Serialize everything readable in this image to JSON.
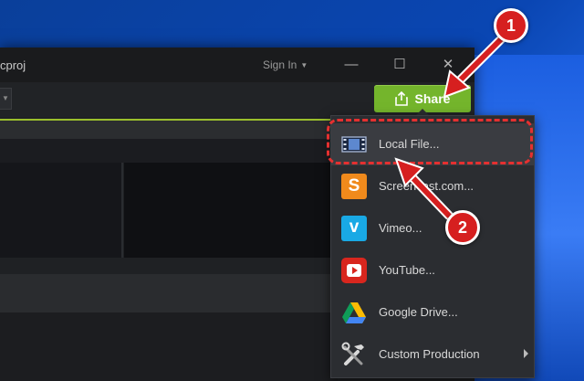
{
  "window": {
    "title": "cproj",
    "sign_in": "Sign In",
    "controls": {
      "minimize": "—",
      "maximize": "☐",
      "close": "✕"
    }
  },
  "share_button": {
    "label": "Share",
    "color": "#74b52c"
  },
  "share_menu": {
    "items": [
      {
        "label": "Local File...",
        "icon": "film-icon"
      },
      {
        "label": "Screencast.com...",
        "icon": "screencast-icon"
      },
      {
        "label": "Vimeo...",
        "icon": "vimeo-icon"
      },
      {
        "label": "YouTube...",
        "icon": "youtube-icon"
      },
      {
        "label": "Google Drive...",
        "icon": "google-drive-icon"
      },
      {
        "label": "Custom Production",
        "icon": "tools-icon"
      }
    ]
  },
  "annotations": {
    "step1": "1",
    "step2": "2",
    "color": "#d61f1f"
  }
}
